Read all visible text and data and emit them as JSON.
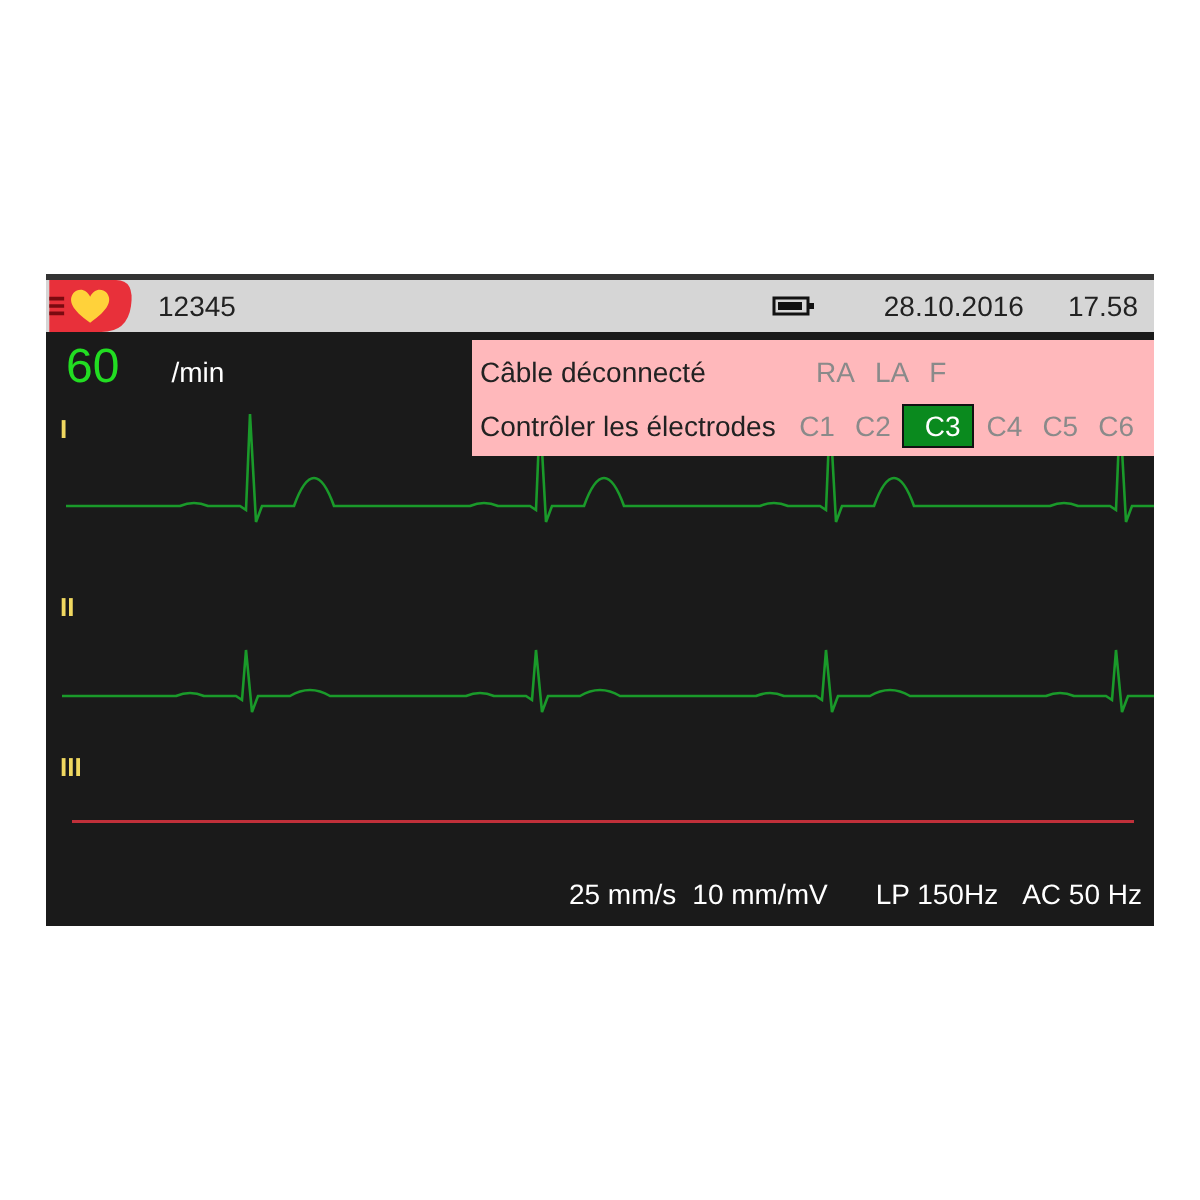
{
  "header": {
    "patient_id": "12345",
    "date": "28.10.2016",
    "time": "17.58"
  },
  "heart_rate": {
    "value": "60",
    "unit": "/min"
  },
  "leads": [
    {
      "label": "I",
      "kind": "ecg"
    },
    {
      "label": "II",
      "kind": "ecg"
    },
    {
      "label": "III",
      "kind": "flat"
    }
  ],
  "alert": {
    "rows": [
      {
        "message": "Câble déconnecté",
        "electrodes": [
          {
            "label": "RA",
            "selected": false
          },
          {
            "label": "LA",
            "selected": false
          },
          {
            "label": "F",
            "selected": false
          }
        ]
      },
      {
        "message": "Contrôler les électrodes",
        "electrodes": [
          {
            "label": "C1",
            "selected": false
          },
          {
            "label": "C2",
            "selected": false
          },
          {
            "label": "C3",
            "selected": true
          },
          {
            "label": "C4",
            "selected": false
          },
          {
            "label": "C5",
            "selected": false
          },
          {
            "label": "C6",
            "selected": false
          }
        ]
      }
    ]
  },
  "footer": {
    "speed": "25 mm/s",
    "gain": "10 mm/mV",
    "filter": "LP 150Hz",
    "ac_filter": "AC 50 Hz"
  }
}
